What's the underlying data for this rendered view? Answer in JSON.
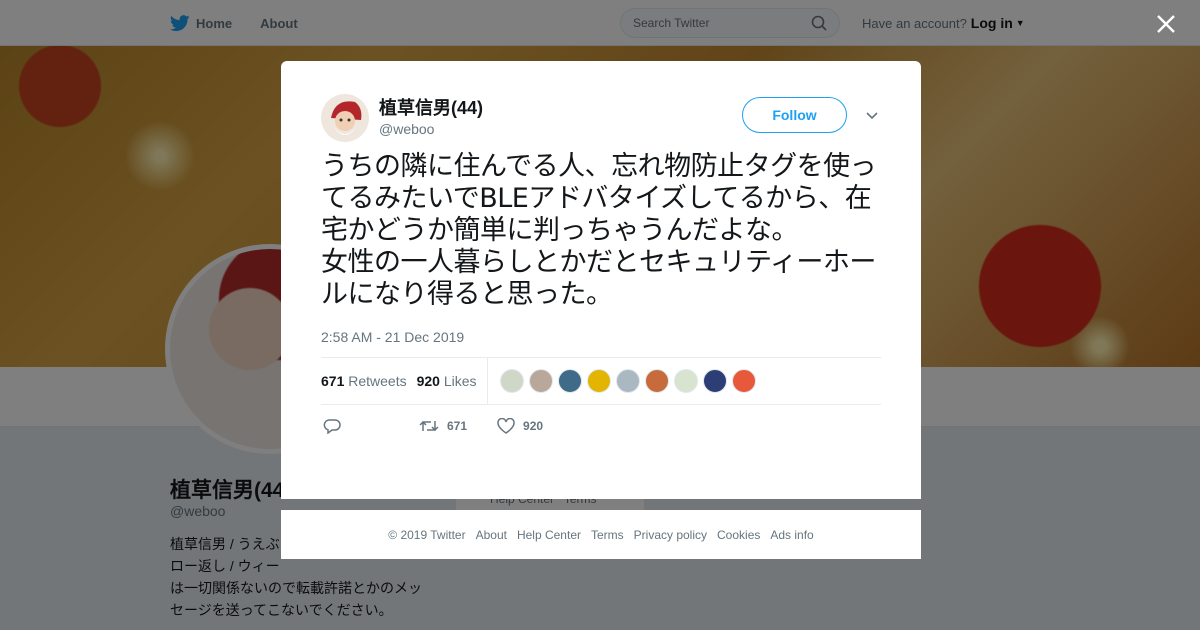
{
  "nav": {
    "home": "Home",
    "about": "About",
    "search_placeholder": "Search Twitter",
    "have_account": "Have an account?",
    "login": "Log in"
  },
  "profile": {
    "name": "植草信男(44",
    "handle": "@weboo",
    "bio": "植草信男 / うえぶ\nロー返し / ウィー\nは一切関係ないので転載許諾とかのメッ\nセージを送ってこないでください。",
    "help_fragment": "Help Center   Terms"
  },
  "tweet": {
    "fullname": "植草信男(44)",
    "screenname": "@weboo",
    "follow_label": "Follow",
    "text": "うちの隣に住んでる人、忘れ物防止タグを使ってるみたいでBLEアドバタイズしてるから、在宅かどうか簡単に判っちゃうんだよな。\n女性の一人暮らしとかだとセキュリティーホールになり得ると思った。",
    "timestamp": "2:58 AM - 21 Dec 2019",
    "retweets_count": "671",
    "retweets_label": "Retweets",
    "likes_count": "920",
    "likes_label": "Likes",
    "action_retweets": "671",
    "action_likes": "920"
  },
  "likers_colors": [
    "#cfd8c8",
    "#b9a79a",
    "#3f6a88",
    "#e3b400",
    "#aab8c2",
    "#c86b3c",
    "#d8e3d0",
    "#2c3e75",
    "#e8583a"
  ],
  "footer": {
    "links": [
      "© 2019 Twitter",
      "About",
      "Help Center",
      "Terms",
      "Privacy policy",
      "Cookies",
      "Ads info"
    ]
  },
  "colors": {
    "brand": "#1da1f2",
    "text_secondary": "#66757f"
  }
}
